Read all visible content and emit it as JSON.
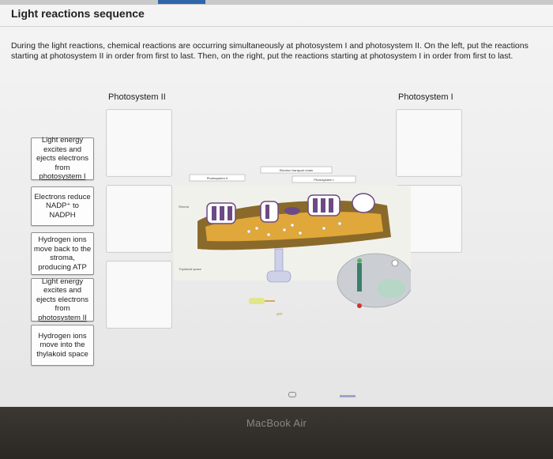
{
  "page": {
    "title": "Light reactions sequence",
    "instructions": "During the light reactions, chemical reactions are occurring simultaneously at photosystem I and photosystem II. On the left, put the reactions starting at photosystem II in order from first to last. Then, on the right, put the reactions starting at photosystem I in order from first to last."
  },
  "columns": {
    "left_title": "Photosystem II",
    "right_title": "Photosystem I"
  },
  "cards": [
    {
      "line1": "Light energy excites and ejects electrons from",
      "line2": "photosystem I"
    },
    {
      "line1": "Electrons reduce NADP⁺ to NADPH",
      "line2": ""
    },
    {
      "line1": "Hydrogen ions move back to the stroma, producing ATP",
      "line2": ""
    },
    {
      "line1": "Light energy excites and ejects electrons from",
      "line2": "photosystem II"
    },
    {
      "line1": "Hydrogen ions move into the thylakoid space",
      "line2": ""
    }
  ],
  "figure": {
    "labels": {
      "ps2": "Photosystem II",
      "etc": "Electron transport chain",
      "ps1": "Photosystem I",
      "stroma": "Stroma",
      "thylakoid_space": "Thylakoid space",
      "atp": "ATP"
    }
  },
  "device": {
    "brand": "MacBook Air"
  },
  "colors": {
    "membrane": "#8a6a2a",
    "lumen": "#e0a73a",
    "protein_purple": "#6d4a86",
    "atp_synthase": "#cdd0e8",
    "card_border": "#8e8e8e"
  }
}
